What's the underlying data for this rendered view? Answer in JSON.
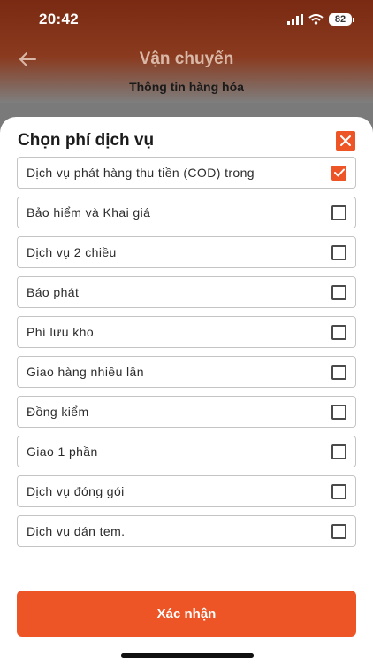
{
  "status_bar": {
    "time": "20:42",
    "battery": "82"
  },
  "header": {
    "title": "Vận chuyển",
    "subtitle": "Thông tin hàng hóa"
  },
  "sheet": {
    "title": "Chọn phí dịch vụ",
    "options": [
      {
        "label": "Dịch vụ phát hàng thu tiền (COD) trong",
        "checked": true
      },
      {
        "label": "Bảo hiểm và Khai giá",
        "checked": false
      },
      {
        "label": "Dịch vụ 2 chiều",
        "checked": false
      },
      {
        "label": "Báo phát",
        "checked": false
      },
      {
        "label": "Phí lưu kho",
        "checked": false
      },
      {
        "label": "Giao hàng nhiều lần",
        "checked": false
      },
      {
        "label": "Đồng kiểm",
        "checked": false
      },
      {
        "label": "Giao 1 phần",
        "checked": false
      },
      {
        "label": "Dịch vụ đóng gói",
        "checked": false
      },
      {
        "label": "Dịch vụ dán tem.",
        "checked": false
      }
    ],
    "confirm_label": "Xác nhận"
  },
  "colors": {
    "accent": "#ee5526",
    "header_bg": "#7a2a12",
    "border": "#c4c4c4"
  }
}
